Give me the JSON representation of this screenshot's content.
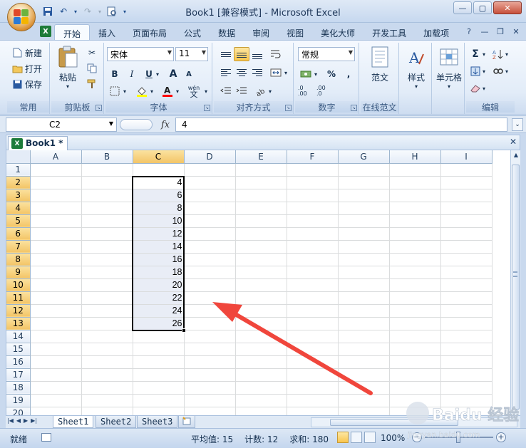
{
  "window": {
    "title": "Book1  [兼容模式] - Microsoft Excel",
    "controls": [
      "minimize",
      "maximize",
      "close"
    ]
  },
  "ribbon_tabs": [
    "开始",
    "插入",
    "页面布局",
    "公式",
    "数据",
    "审阅",
    "视图",
    "美化大师",
    "开发工具",
    "加载项"
  ],
  "active_tab": "开始",
  "ribbon": {
    "clipboard": {
      "new_label": "新建",
      "open_label": "打开",
      "save_label": "保存",
      "paste_label": "粘贴",
      "group_common": "常用",
      "group_label": "剪贴板"
    },
    "font": {
      "name": "宋体",
      "size": "11",
      "group_label": "字体",
      "bold": "B",
      "italic": "I",
      "underline": "U",
      "grow": "A",
      "shrink": "A",
      "phonetic_top": "wén",
      "phonetic_bottom": "文",
      "font_color": "#ff0000",
      "fill_color": "#ffff00"
    },
    "alignment": {
      "group_label": "对齐方式"
    },
    "number": {
      "format": "常规",
      "group_label": "数字",
      "percent": "%",
      "comma": ",",
      "inc_decimal": ".0 .00",
      "dec_decimal": ".00 .0"
    },
    "template": {
      "label": "范文",
      "group_label": "在线范文"
    },
    "styles": {
      "label": "样式"
    },
    "cells": {
      "label": "单元格"
    },
    "editing": {
      "group_label": "编辑",
      "sigma": "Σ"
    }
  },
  "formula_bar": {
    "name_box": "C2",
    "fx": "fx",
    "content": "4"
  },
  "workbook": {
    "tab_title": "Book1 *"
  },
  "grid": {
    "columns": [
      "A",
      "B",
      "C",
      "D",
      "E",
      "F",
      "G",
      "H",
      "I"
    ],
    "rows": [
      "1",
      "2",
      "3",
      "4",
      "5",
      "6",
      "7",
      "8",
      "9",
      "10",
      "11",
      "12",
      "13",
      "14",
      "15",
      "16",
      "17",
      "18",
      "19",
      "20"
    ],
    "selected_column": "C",
    "selected_rows": [
      "2",
      "3",
      "4",
      "5",
      "6",
      "7",
      "8",
      "9",
      "10",
      "11",
      "12",
      "13"
    ],
    "column_c_values": [
      "",
      "4",
      "6",
      "8",
      "10",
      "12",
      "14",
      "16",
      "18",
      "20",
      "22",
      "24",
      "26",
      "",
      "",
      "",
      "",
      "",
      "",
      ""
    ]
  },
  "sheets": [
    "Sheet1",
    "Sheet2",
    "Sheet3"
  ],
  "active_sheet": "Sheet1",
  "status": {
    "ready": "就绪",
    "average": "平均值: 15",
    "count": "计数: 12",
    "sum": "求和: 180",
    "zoom": "100%"
  },
  "watermark": {
    "brand": "Baidu 经验",
    "url": "jingyan.baidu.com"
  },
  "colors": {
    "arrow": "#f0463c",
    "selection_fill": "#e9edf6",
    "header_highlight": "#f3c567"
  }
}
